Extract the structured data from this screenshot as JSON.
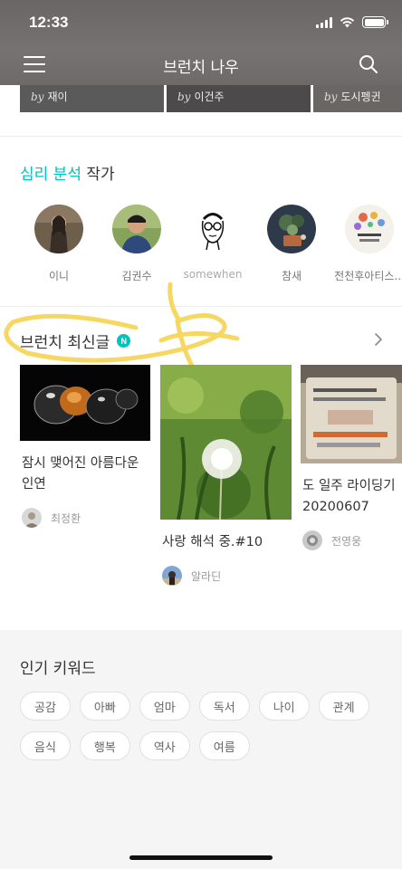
{
  "status_bar": {
    "time": "12:33"
  },
  "nav": {
    "title": "브런치 나우"
  },
  "top_strip": [
    {
      "by": "by",
      "author": "재이"
    },
    {
      "by": "by",
      "author": "이건주"
    },
    {
      "by": "by",
      "author": "도시펭귄"
    }
  ],
  "psych_section": {
    "title_accent": "심리 분석",
    "title_rest": " 작가",
    "authors": [
      {
        "name": "이니"
      },
      {
        "name": "김권수"
      },
      {
        "name": "somewhen"
      },
      {
        "name": "참새"
      },
      {
        "name": "전천후아티스..."
      }
    ]
  },
  "latest": {
    "title": "브런치 최신글",
    "badge": "N",
    "posts": [
      {
        "title": "잠시 맺어진 아름다운 인연",
        "author": "최정환"
      },
      {
        "title": "사랑 해석 중.#10",
        "author": "알라딘"
      },
      {
        "title": "도 일주 라이딩기 20200607",
        "author": "전영웅"
      }
    ]
  },
  "keywords": {
    "title": "인기 키워드",
    "row1": [
      "공감",
      "아빠",
      "엄마",
      "독서",
      "나이",
      "관계"
    ],
    "row2": [
      "음식",
      "행복",
      "역사",
      "여름"
    ]
  },
  "colors": {
    "accent": "#00c3bd",
    "highlight_scribble": "#f5d24b"
  }
}
